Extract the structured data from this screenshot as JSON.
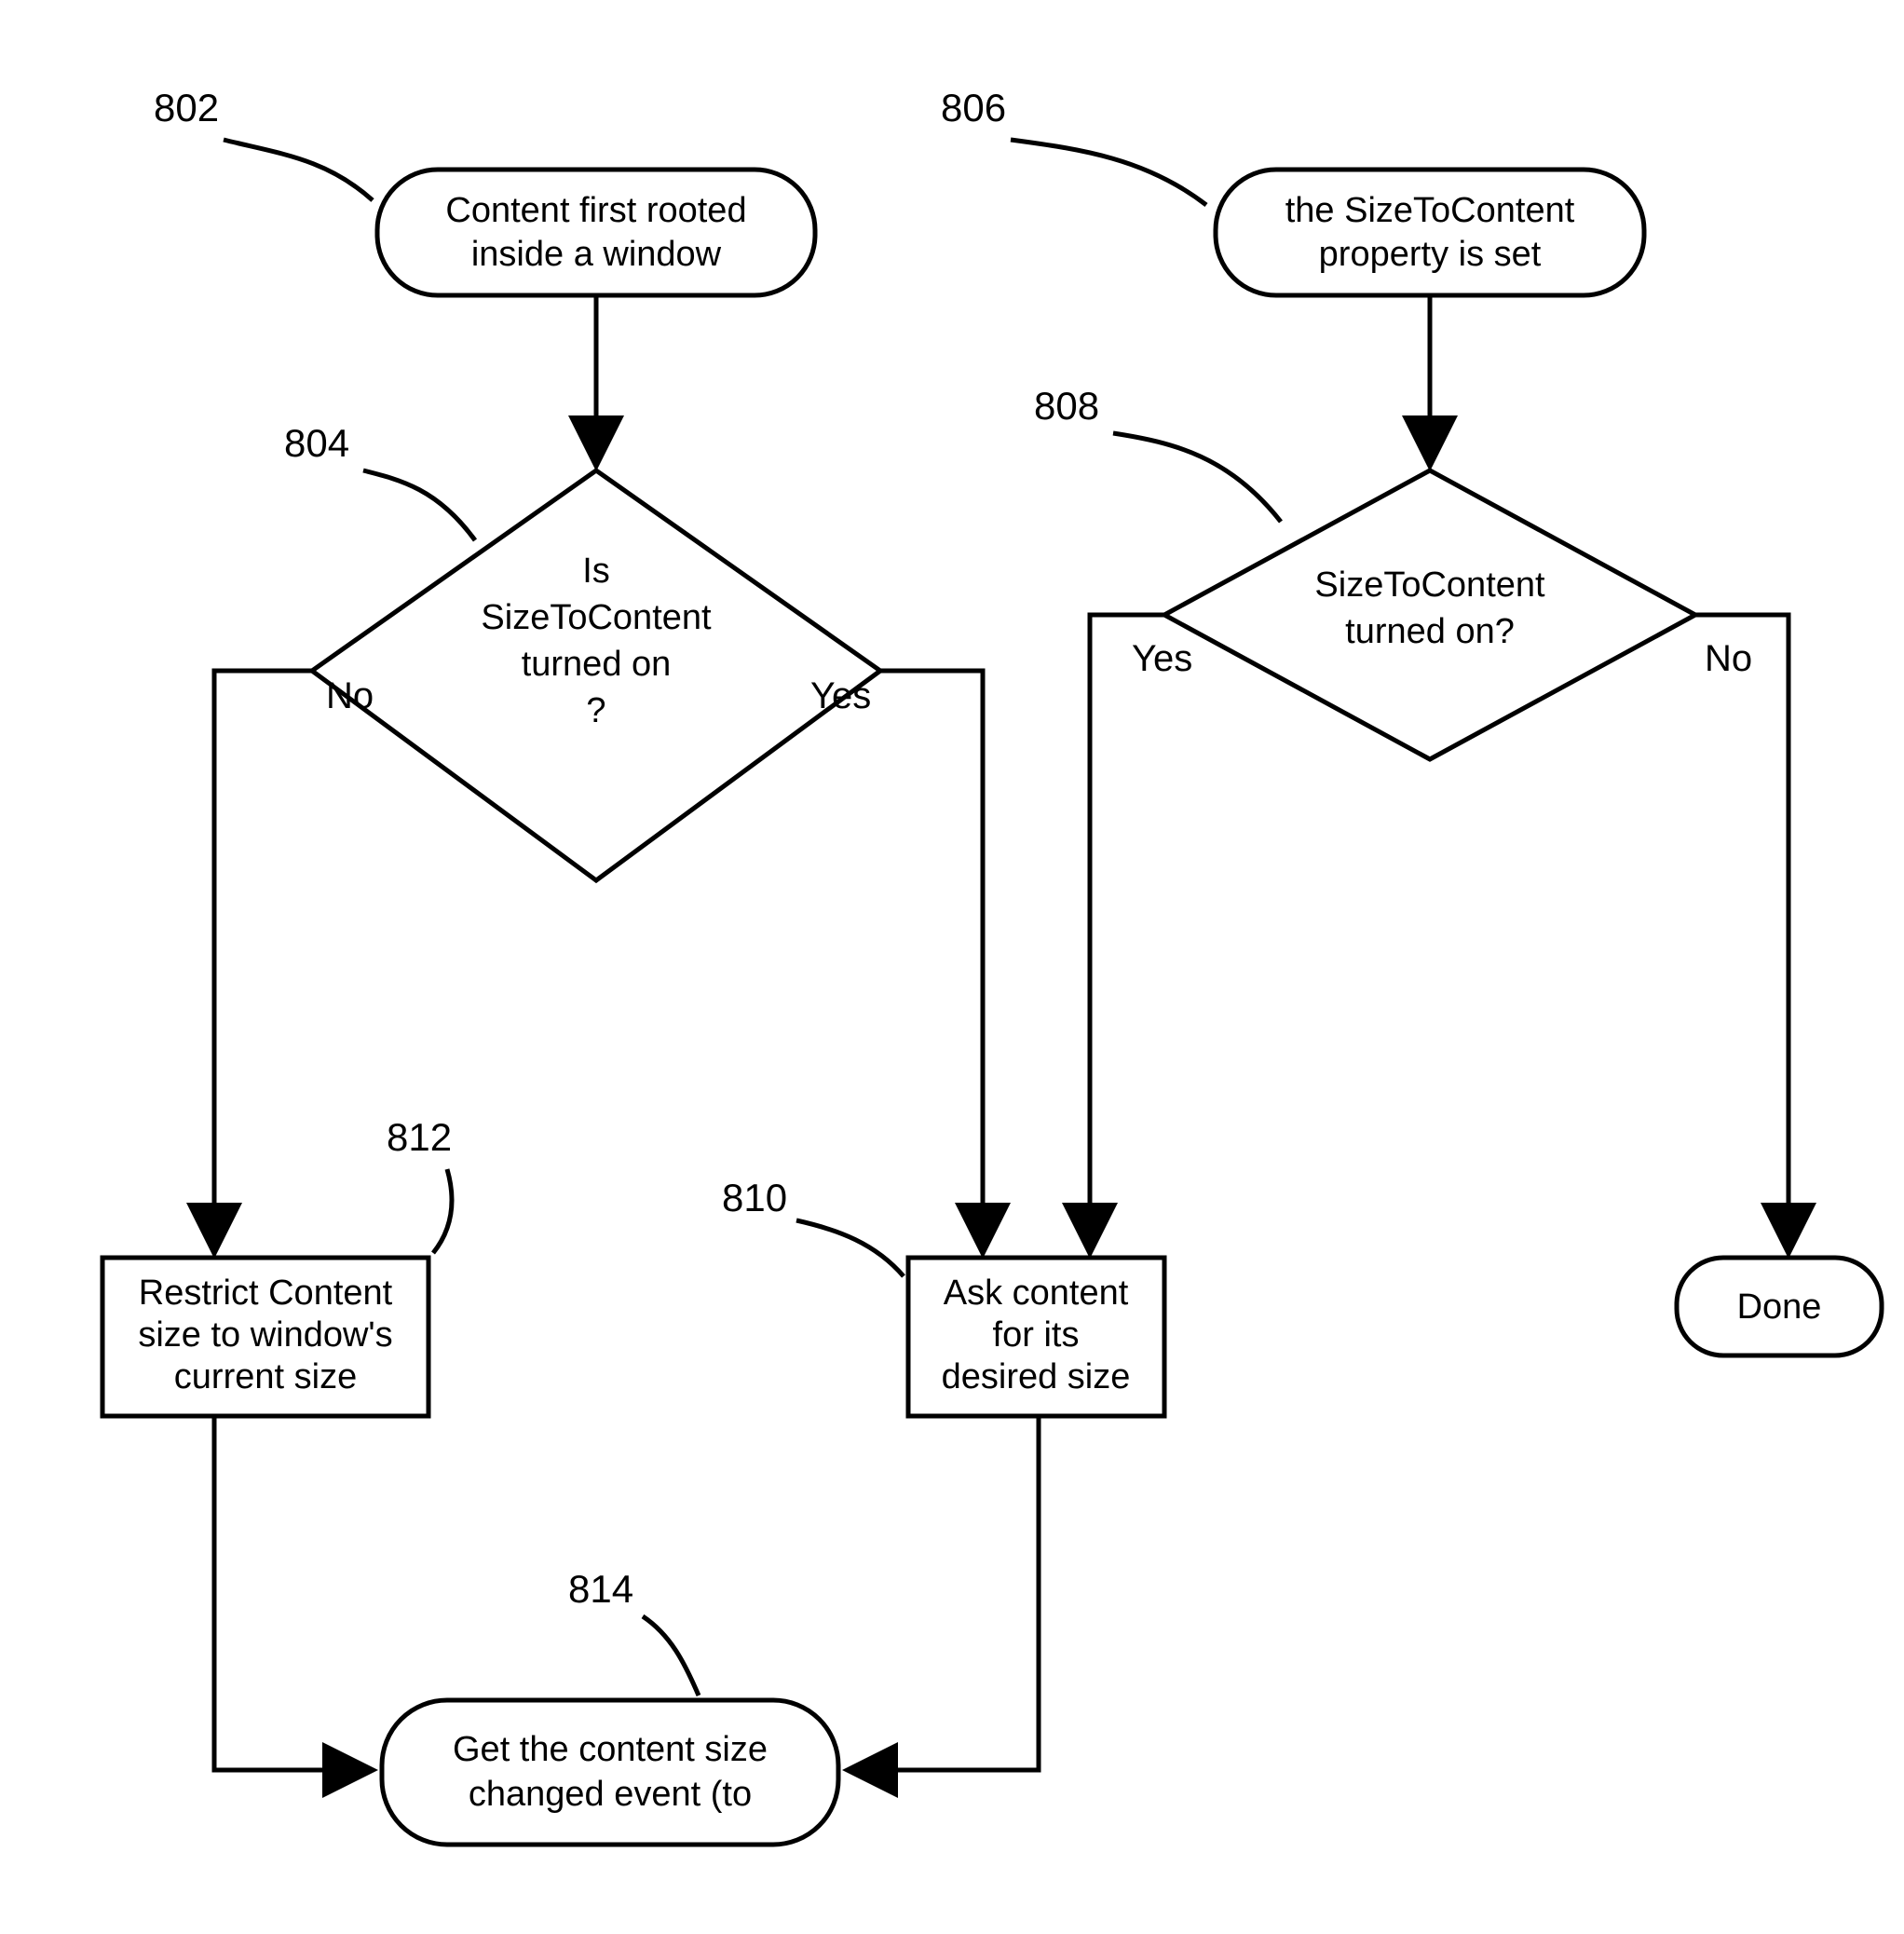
{
  "refs": {
    "r802": "802",
    "r804": "804",
    "r806": "806",
    "r808": "808",
    "r810": "810",
    "r812": "812",
    "r814": "814"
  },
  "nodes": {
    "n802": {
      "l1": "Content first rooted",
      "l2": "inside a window"
    },
    "n806": {
      "l1": "the SizeToContent",
      "l2": "property is set"
    },
    "n804": {
      "l1": "Is",
      "l2": "SizeToContent",
      "l3": "turned on",
      "l4": "?"
    },
    "n808": {
      "l1": "SizeToContent",
      "l2": "turned on?"
    },
    "n812": {
      "l1": "Restrict Content",
      "l2": "size to window's",
      "l3": "current size"
    },
    "n810": {
      "l1": "Ask content",
      "l2": "for its",
      "l3": "desired size"
    },
    "n814": {
      "l1": "Get the content size",
      "l2": "changed event (to"
    },
    "done": {
      "l1": "Done"
    }
  },
  "labels": {
    "no": "No",
    "yes": "Yes"
  }
}
